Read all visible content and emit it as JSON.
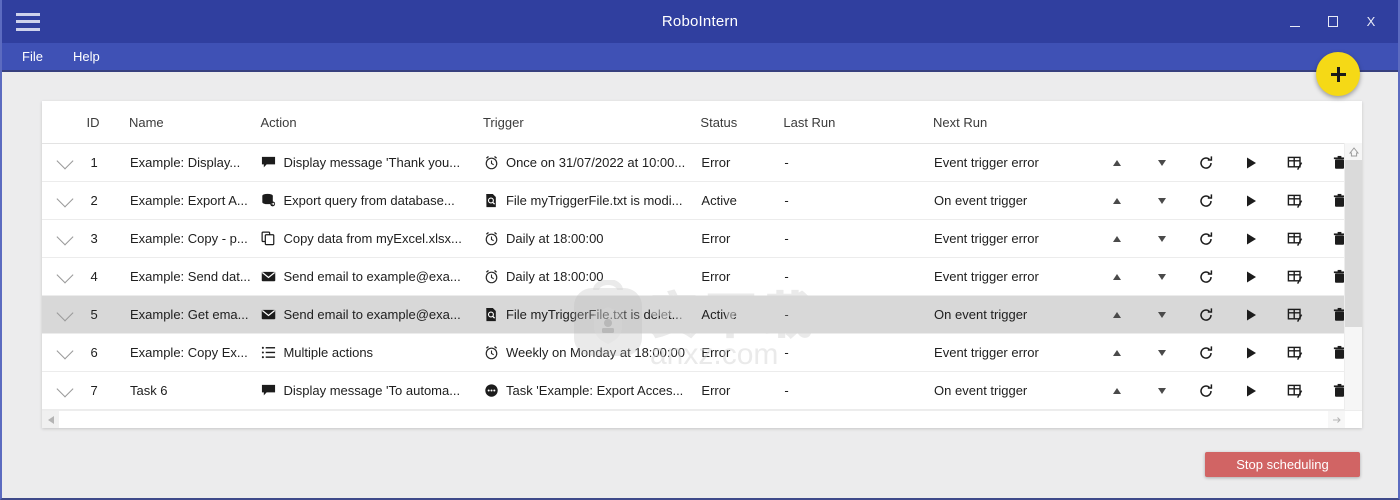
{
  "window": {
    "title": "RoboIntern",
    "menu_icon": "hamburger-icon",
    "controls": {
      "minimize": "_",
      "maximize": "▢",
      "close": "X"
    }
  },
  "menubar": {
    "items": [
      {
        "label": "File"
      },
      {
        "label": "Help"
      }
    ]
  },
  "fab": {
    "label": "+",
    "icon": "plus-icon",
    "color": "#f5d916"
  },
  "table": {
    "headers": [
      "ID",
      "Name",
      "Action",
      "Trigger",
      "Status",
      "Last Run",
      "Next Run"
    ],
    "rows": [
      {
        "id": "1",
        "name": "Example: Display...",
        "action": "Display message 'Thank you...",
        "action_icon": "message-icon",
        "trigger": "Once on 31/07/2022 at 10:00...",
        "trigger_icon": "alarm-clock-icon",
        "status": "Error",
        "last_run": "-",
        "next_run": "Event trigger error",
        "selected": false
      },
      {
        "id": "2",
        "name": "Example: Export A...",
        "action": "Export query from database...",
        "action_icon": "database-icon",
        "trigger": "File myTriggerFile.txt is modi...",
        "trigger_icon": "file-search-icon",
        "status": "Active",
        "last_run": "-",
        "next_run": "On event trigger",
        "selected": false
      },
      {
        "id": "3",
        "name": "Example: Copy - p...",
        "action": "Copy data from myExcel.xlsx...",
        "action_icon": "copy-icon",
        "trigger": "Daily at 18:00:00",
        "trigger_icon": "alarm-clock-icon",
        "status": "Error",
        "last_run": "-",
        "next_run": "Event trigger error",
        "selected": false
      },
      {
        "id": "4",
        "name": "Example: Send dat...",
        "action": "Send email to example@exa...",
        "action_icon": "envelope-icon",
        "trigger": "Daily at 18:00:00",
        "trigger_icon": "alarm-clock-icon",
        "status": "Error",
        "last_run": "-",
        "next_run": "Event trigger error",
        "selected": false
      },
      {
        "id": "5",
        "name": "Example: Get ema...",
        "action": "Send email to example@exa...",
        "action_icon": "envelope-icon",
        "trigger": "File myTriggerFile.txt is delet...",
        "trigger_icon": "file-search-icon",
        "status": "Active",
        "last_run": "-",
        "next_run": "On event trigger",
        "selected": true
      },
      {
        "id": "6",
        "name": "Example: Copy Ex...",
        "action": "Multiple actions",
        "action_icon": "list-icon",
        "trigger": "Weekly on Monday at 18:00:00",
        "trigger_icon": "alarm-clock-icon",
        "status": "Error",
        "last_run": "-",
        "next_run": "Event trigger error",
        "selected": false
      },
      {
        "id": "7",
        "name": "Task 6",
        "action": "Display message 'To automa...",
        "action_icon": "message-icon",
        "trigger": "Task 'Example: Export Acces...",
        "trigger_icon": "task-dots-icon",
        "status": "Error",
        "last_run": "-",
        "next_run": "On event trigger",
        "selected": false
      }
    ],
    "row_actions": [
      "move-up-icon",
      "move-down-icon",
      "refresh-icon",
      "run-icon",
      "edit-table-icon",
      "delete-icon"
    ]
  },
  "footer": {
    "stop_button": "Stop scheduling",
    "stop_button_color": "#d16464"
  },
  "watermark": {
    "text_cn": "安下载",
    "text_en": "anxz.com"
  }
}
